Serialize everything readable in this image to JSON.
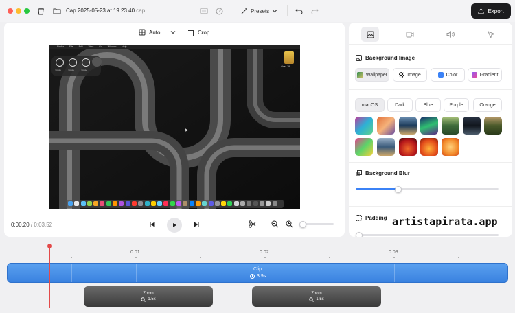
{
  "titlebar": {
    "filename": "Cap 2025-05-23 at 19.23.40",
    "ext": ".cap",
    "presets_label": "Presets",
    "export_label": "Export"
  },
  "preview": {
    "aspect_label": "Auto",
    "crop_label": "Crop",
    "time_current": "0:00.20",
    "time_sep": "/",
    "time_total": "0:03.52",
    "overlay_percents": [
      "100%",
      "100%",
      "100%"
    ],
    "menubar": [
      "Finder",
      "File",
      "Edit",
      "View",
      "Go",
      "Window",
      "Help"
    ],
    "desktop_file": "Ahaa 19/"
  },
  "panel": {
    "bg_title": "Background Image",
    "bg_tabs": [
      "Wallpaper",
      "Image",
      "Color",
      "Gradient"
    ],
    "themes": [
      "macOS",
      "Dark",
      "Blue",
      "Purple",
      "Orange"
    ],
    "blur_title": "Background Blur",
    "blur_value": 0.3,
    "padding_title": "Padding",
    "padding_value": 0
  },
  "timeline": {
    "ticks": [
      "0:01",
      "0:02",
      "0:03"
    ],
    "clip_label": "Clip",
    "clip_duration": "3.9s",
    "zooms": [
      {
        "label": "Zoom",
        "value": "1.5x"
      },
      {
        "label": "Zoom",
        "value": "1.5x"
      }
    ]
  },
  "watermark": "artistapirata.app"
}
